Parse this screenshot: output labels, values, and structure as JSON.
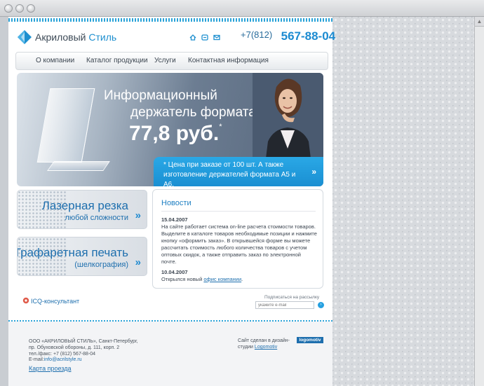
{
  "logo": {
    "name_part1": "Акриловый",
    "name_part2": "Стиль"
  },
  "header": {
    "icons": [
      "home-icon",
      "sitemap-icon",
      "mail-icon"
    ],
    "phone_code": "+7(812)",
    "phone_number": "567-88-04"
  },
  "nav": {
    "items": [
      {
        "label": "О компании"
      },
      {
        "label": "Каталог продукции"
      },
      {
        "label": "Услуги"
      },
      {
        "label": "Контактная информация"
      }
    ]
  },
  "banner": {
    "line1": "Информационный",
    "line2": "держатель формата А4",
    "price": "77,8 руб.",
    "price_mark": "*",
    "note": "* Цена при заказе от 100 шт. А также изготовление держателей формата А5 и А6.",
    "arrows": "»"
  },
  "promos": [
    {
      "title": "Лазерная резка",
      "subtitle": "любой сложности",
      "arrows": "»"
    },
    {
      "title": "Трафаретная печать",
      "subtitle": "(шелкография)",
      "arrows": "»"
    }
  ],
  "news": {
    "title": "Новости",
    "items": [
      {
        "date": "15.04.2007",
        "text": "На сайте работает система on-line расчета стоимости товаров. Выделите в каталоге товаров необходимые позиции и нажмите кнопку «оформить заказ». В открывшейся форме вы можете рассчитать стоимость любого количества товаров с учетом оптовых скидок, а также отправить заказ по электронной почте."
      },
      {
        "date": "10.04.2007",
        "text_before": "Открылся новый ",
        "link": "офис компании",
        "text_after": "."
      }
    ]
  },
  "icq": {
    "label": "ICQ-консультант"
  },
  "subscribe": {
    "label": "Подписаться на рассылку",
    "placeholder": "укажите e-mail"
  },
  "footer": {
    "address": "ООО «АКРИЛОВЫЙ СТИЛЬ», Санкт-Петербург,\nпр. Обуховской обороны, д. 111, корп. 2\nтел./факс: +7 (812) 567-88-04",
    "email_label": "E-mail:",
    "email": "info@acrilstyle.ru",
    "map_link": "Карта проезда",
    "made_line1": "Сайт сделан в дизайн-",
    "made_line2": "студии",
    "studio": "Logomotiv",
    "studio_badge": "logomotiv"
  },
  "colors": {
    "accent": "#1d8fcf",
    "phone": "#1c8bd1",
    "note_bg": "#1a8fd2"
  }
}
